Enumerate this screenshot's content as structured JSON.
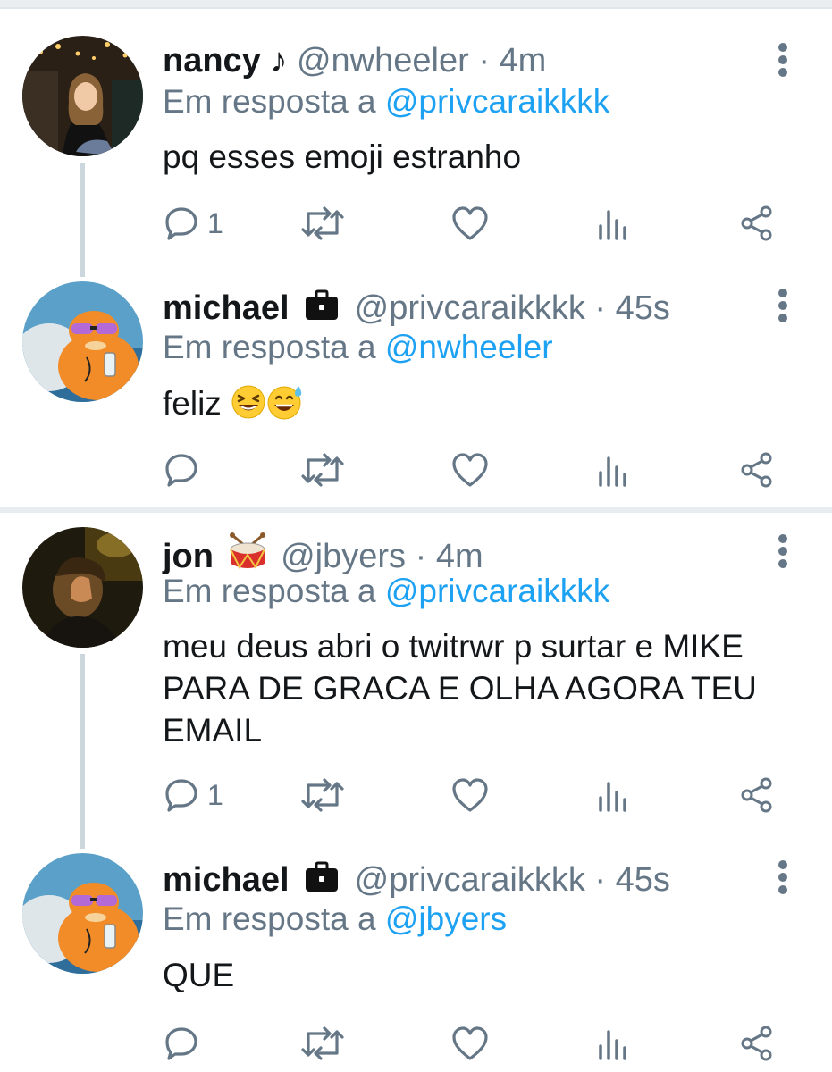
{
  "colors": {
    "link": "#1da1f2",
    "muted": "#657786",
    "text": "#14171a",
    "line": "#ccd6dd"
  },
  "tweets": [
    {
      "name": "nancy",
      "name_decoration": "♪",
      "handle": "@nwheeler",
      "separator": "·",
      "time": "4m",
      "reply_prefix": "Em resposta a",
      "reply_to": "@privcaraikkkk",
      "text": "pq esses emoji estranho",
      "reply_count": "1",
      "avatar": "photo-girl-avatar"
    },
    {
      "name": "michael",
      "name_decoration": "briefcase-emoji",
      "handle": "@privcaraikkkk",
      "separator": "·",
      "time": "45s",
      "reply_prefix": "Em resposta a",
      "reply_to": "@nwheeler",
      "text": "feliz",
      "emojis": [
        "laughing-face-emoji",
        "grinning-sweat-emoji"
      ],
      "reply_count": "",
      "avatar": "cartoon-cat-avatar"
    },
    {
      "name": "jon",
      "name_decoration": "drum-emoji",
      "handle": "@jbyers",
      "separator": "·",
      "time": "4m",
      "reply_prefix": "Em resposta a",
      "reply_to": "@privcaraikkkk",
      "text": "meu deus abri o twitrwr p surtar e MIKE PARA DE GRACA E OLHA AGORA TEU EMAIL",
      "reply_count": "1",
      "avatar": "photo-boy-avatar"
    },
    {
      "name": "michael",
      "name_decoration": "briefcase-emoji",
      "handle": "@privcaraikkkk",
      "separator": "·",
      "time": "45s",
      "reply_prefix": "Em resposta a",
      "reply_to": "@jbyers",
      "text": "QUE",
      "reply_count": "",
      "avatar": "cartoon-cat-avatar"
    }
  ],
  "action_icons": [
    "reply-icon",
    "retweet-icon",
    "like-icon",
    "analytics-icon",
    "share-icon"
  ]
}
